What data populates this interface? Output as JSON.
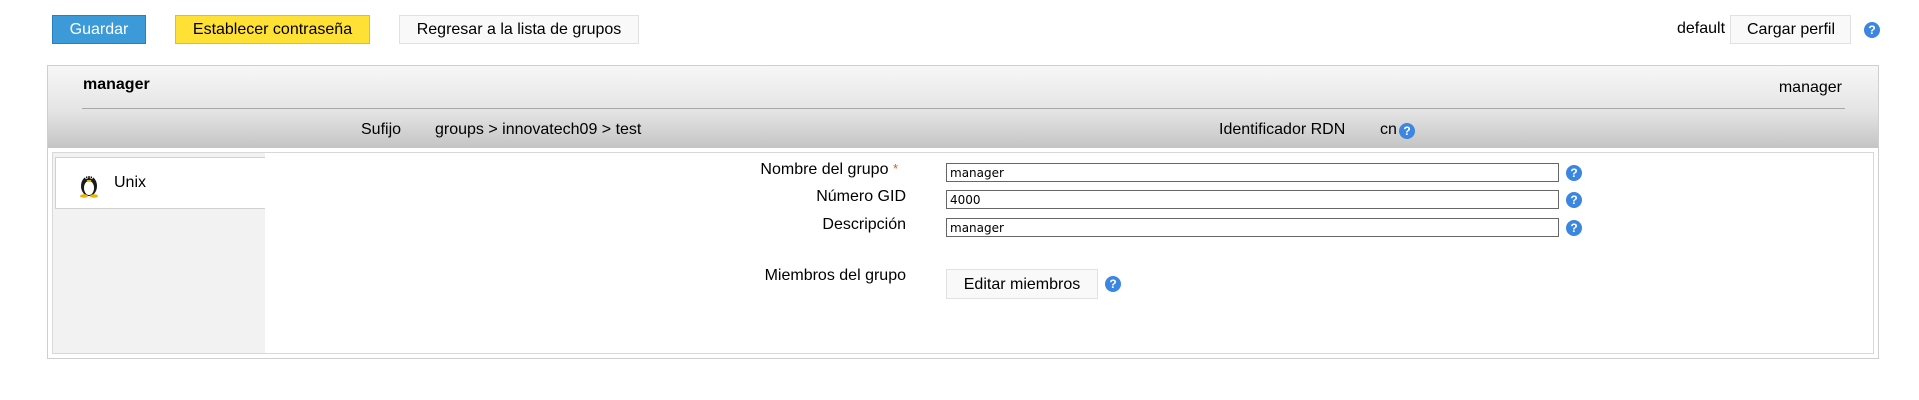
{
  "toolbar": {
    "save_label": "Guardar",
    "set_password_label": "Establecer contraseña",
    "back_label": "Regresar a la lista de grupos",
    "profile_value": "default",
    "load_profile_label": "Cargar perfil"
  },
  "header": {
    "title": "manager",
    "title_right": "manager",
    "suffix_label": "Sufijo",
    "suffix_value": "groups > innovatech09 > test",
    "rdn_label": "Identificador RDN",
    "rdn_value": "cn"
  },
  "tabs": [
    {
      "label": "Unix",
      "icon": "tux-icon"
    }
  ],
  "form": {
    "group_name_label": "Nombre del grupo",
    "required_mark": "*",
    "group_name_value": "manager",
    "gid_label": "Número GID",
    "gid_value": "4000",
    "description_label": "Descripción",
    "description_value": "manager",
    "members_label": "Miembros del grupo",
    "edit_members_label": "Editar miembros"
  },
  "help_icon_glyph": "?",
  "colors": {
    "save_button": "#3d9ad9",
    "password_button": "#ffe135",
    "help_icon": "#3a86e0",
    "required_mark": "#e05a1e"
  }
}
